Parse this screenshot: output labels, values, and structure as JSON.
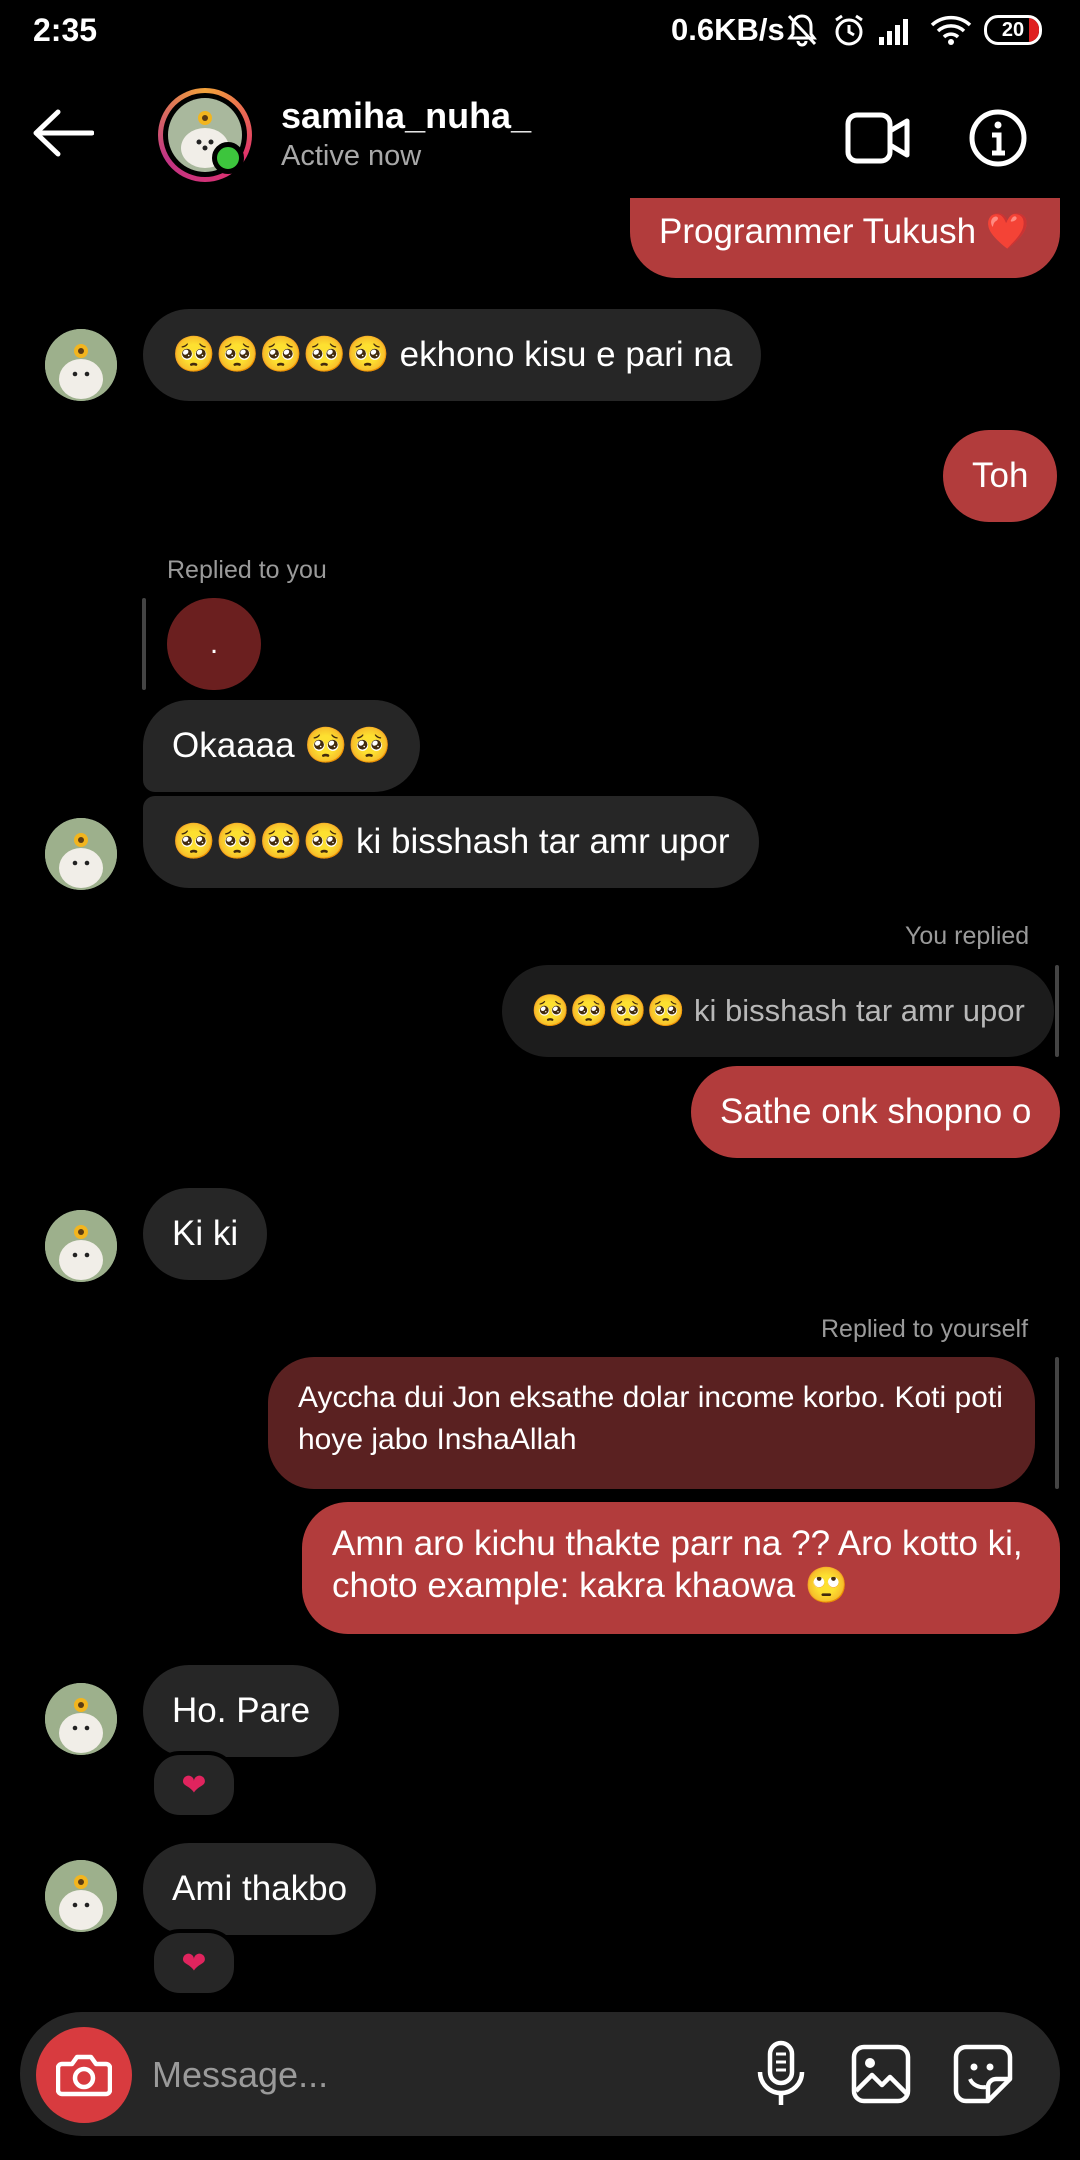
{
  "status_bar": {
    "time": "2:35",
    "network_speed": "0.6KB/s",
    "battery": "20"
  },
  "header": {
    "username": "samiha_nuha_",
    "status": "Active now"
  },
  "messages": {
    "m1": "Programmer Tukush ❤️",
    "m2": "🥺🥺🥺🥺🥺 ekhono kisu e pari na",
    "m3": "Toh",
    "m4_meta": "Replied to you",
    "m4_quote": ".",
    "m4": "Okaaaa 🥺🥺",
    "m5": "🥺🥺🥺🥺 ki bisshash tar amr upor",
    "m6_meta": "You replied",
    "m6_quote": "🥺🥺🥺🥺 ki bisshash tar amr upor",
    "m6": "Sathe onk shopno o",
    "m7": "Ki ki",
    "m8_meta": "Replied to yourself",
    "m8_quote_line1": "Ayccha dui Jon eksathe dolar income korbo. Koti poti",
    "m8_quote_line2": "hoye jabo InshaAllah",
    "m8_line1": "Amn aro kichu thakte parr na ?? Aro kotto ki,",
    "m8_line2": "choto example: kakra khaowa 🙄",
    "m9": "Ho. Pare",
    "m9_reaction": "❤",
    "m10": "Ami thakbo",
    "m10_reaction": "❤"
  },
  "composer": {
    "placeholder": "Message..."
  },
  "colors": {
    "outgoing_bubble": "#b23c3c",
    "incoming_bubble": "#262626",
    "camera_button": "#d83b3f",
    "online": "#3dc53d"
  }
}
